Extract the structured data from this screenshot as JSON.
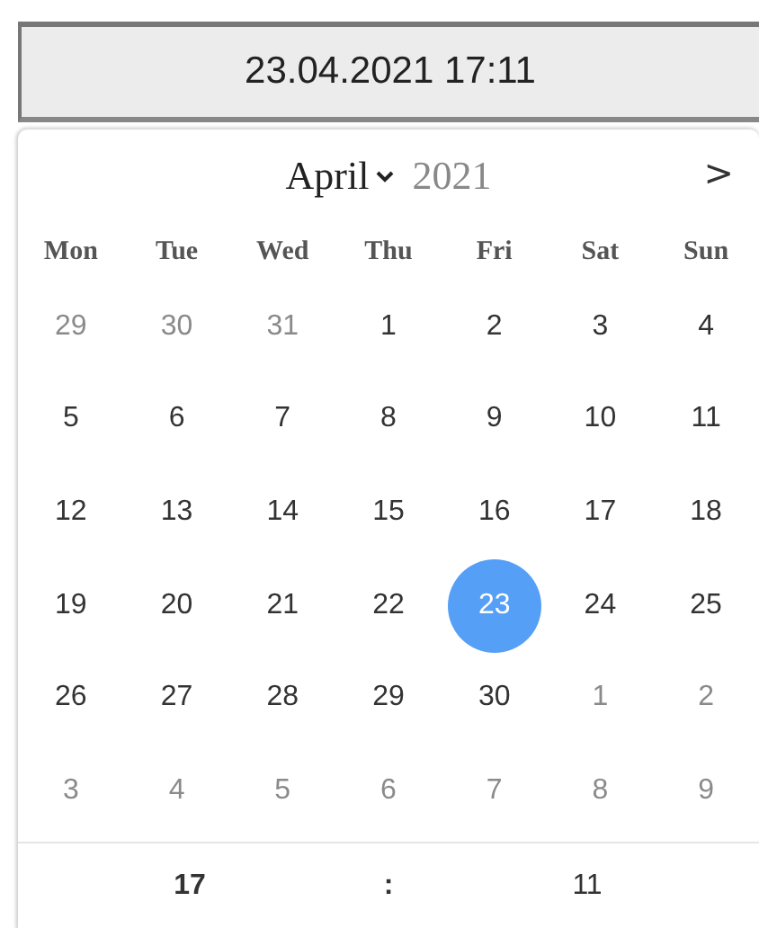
{
  "input": {
    "value": "23.04.2021 17:11"
  },
  "calendar": {
    "month": "April",
    "year": "2021",
    "next": ">",
    "weekdays": [
      "Mon",
      "Tue",
      "Wed",
      "Thu",
      "Fri",
      "Sat",
      "Sun"
    ],
    "days": [
      {
        "label": "29",
        "outside": true,
        "selected": false
      },
      {
        "label": "30",
        "outside": true,
        "selected": false
      },
      {
        "label": "31",
        "outside": true,
        "selected": false
      },
      {
        "label": "1",
        "outside": false,
        "selected": false
      },
      {
        "label": "2",
        "outside": false,
        "selected": false
      },
      {
        "label": "3",
        "outside": false,
        "selected": false
      },
      {
        "label": "4",
        "outside": false,
        "selected": false
      },
      {
        "label": "5",
        "outside": false,
        "selected": false
      },
      {
        "label": "6",
        "outside": false,
        "selected": false
      },
      {
        "label": "7",
        "outside": false,
        "selected": false
      },
      {
        "label": "8",
        "outside": false,
        "selected": false
      },
      {
        "label": "9",
        "outside": false,
        "selected": false
      },
      {
        "label": "10",
        "outside": false,
        "selected": false
      },
      {
        "label": "11",
        "outside": false,
        "selected": false
      },
      {
        "label": "12",
        "outside": false,
        "selected": false
      },
      {
        "label": "13",
        "outside": false,
        "selected": false
      },
      {
        "label": "14",
        "outside": false,
        "selected": false
      },
      {
        "label": "15",
        "outside": false,
        "selected": false
      },
      {
        "label": "16",
        "outside": false,
        "selected": false
      },
      {
        "label": "17",
        "outside": false,
        "selected": false
      },
      {
        "label": "18",
        "outside": false,
        "selected": false
      },
      {
        "label": "19",
        "outside": false,
        "selected": false
      },
      {
        "label": "20",
        "outside": false,
        "selected": false
      },
      {
        "label": "21",
        "outside": false,
        "selected": false
      },
      {
        "label": "22",
        "outside": false,
        "selected": false
      },
      {
        "label": "23",
        "outside": false,
        "selected": true
      },
      {
        "label": "24",
        "outside": false,
        "selected": false
      },
      {
        "label": "25",
        "outside": false,
        "selected": false
      },
      {
        "label": "26",
        "outside": false,
        "selected": false
      },
      {
        "label": "27",
        "outside": false,
        "selected": false
      },
      {
        "label": "28",
        "outside": false,
        "selected": false
      },
      {
        "label": "29",
        "outside": false,
        "selected": false
      },
      {
        "label": "30",
        "outside": false,
        "selected": false
      },
      {
        "label": "1",
        "outside": true,
        "selected": false
      },
      {
        "label": "2",
        "outside": true,
        "selected": false
      },
      {
        "label": "3",
        "outside": true,
        "selected": false
      },
      {
        "label": "4",
        "outside": true,
        "selected": false
      },
      {
        "label": "5",
        "outside": true,
        "selected": false
      },
      {
        "label": "6",
        "outside": true,
        "selected": false
      },
      {
        "label": "7",
        "outside": true,
        "selected": false
      },
      {
        "label": "8",
        "outside": true,
        "selected": false
      },
      {
        "label": "9",
        "outside": true,
        "selected": false
      }
    ]
  },
  "time": {
    "hour": "17",
    "separator": ":",
    "minute": "11"
  }
}
